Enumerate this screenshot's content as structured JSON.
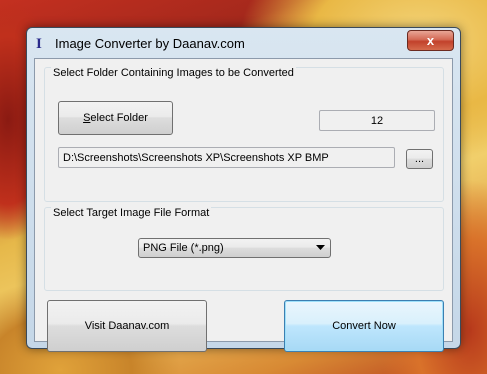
{
  "window": {
    "title": "Image Converter by Daanav.com",
    "app_icon_glyph": "I",
    "close_glyph": "x"
  },
  "source_group": {
    "label": "Select Folder Containing Images to be Converted",
    "select_folder_access_key": "S",
    "select_folder_rest": "elect Folder",
    "image_count": "12",
    "folder_path": "D:\\Screenshots\\Screenshots XP\\Screenshots XP BMP",
    "browse_label": "..."
  },
  "format_group": {
    "label": "Select Target Image File Format",
    "selected_format": "PNG File (*.png)"
  },
  "actions": {
    "visit_label": "Visit Daanav.com",
    "convert_label": "Convert Now"
  }
}
